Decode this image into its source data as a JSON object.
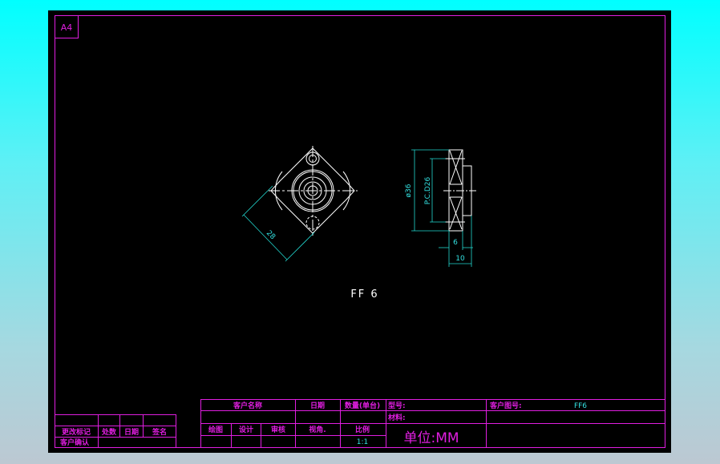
{
  "sheet": {
    "size_label": "A4",
    "part_label": "FF 6"
  },
  "dimensions": {
    "diamond_width": "28",
    "outer_diameter": "ø36",
    "pcd": "P.C.D26",
    "hub_thickness": "6",
    "total_thickness": "10"
  },
  "title_block": {
    "customer_name": "客户名称",
    "date": "日期",
    "quantity": "数量(单台)",
    "model": "型号:",
    "customer_drawing_no": "客户图号:",
    "customer_drawing_no_value": "FF6",
    "material": "材料:",
    "drawn": "绘图",
    "design": "设计",
    "review": "审核",
    "view_angle": "视角.",
    "scale": "比例",
    "scale_value": "1:1",
    "unit": "单位:MM"
  },
  "revision_block": {
    "change_mark": "更改标记",
    "count": "处数",
    "date": "日期",
    "signature": "签名",
    "customer_confirm": "客户确认"
  },
  "colors": {
    "border": "#e01ee0",
    "drawing": "#ffffff",
    "dimension": "#22d8d0",
    "paper": "#000000"
  }
}
